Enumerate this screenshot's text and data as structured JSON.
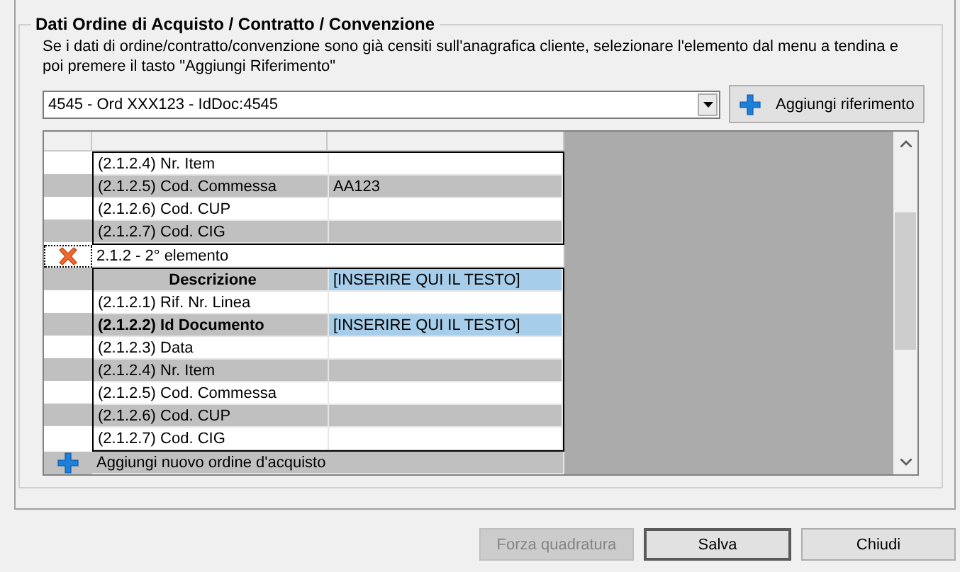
{
  "group": {
    "title": "Dati Ordine di Acquisto / Contratto / Convenzione",
    "instructions": "Se i dati di ordine/contratto/convenzione sono già censiti sull'anagrafica cliente, selezionare l'elemento dal menu a tendina e poi premere il tasto \"Aggiungi Riferimento\"",
    "reference_select": {
      "value": "4545 - Ord XXX123 - IdDoc:4545"
    },
    "add_reference_button": "Aggiungi riferimento",
    "grid": {
      "sections": [
        {
          "kind": "fields",
          "rows": [
            {
              "kind": "field",
              "label": "(2.1.2.4) Nr. Item",
              "required": false
            },
            {
              "kind": "field",
              "label": "(2.1.2.5) Cod. Commessa",
              "value": "AA123",
              "required": false
            },
            {
              "kind": "field",
              "label": "(2.1.2.6) Cod. CUP",
              "required": false
            },
            {
              "kind": "field",
              "label": "(2.1.2.7) Cod. CIG",
              "required": false
            }
          ]
        },
        {
          "kind": "element",
          "label": "2.1.2 - 2° elemento"
        },
        {
          "kind": "fields",
          "rows": [
            {
              "kind": "header",
              "label": "Descrizione",
              "value": "[INSERIRE QUI IL TESTO]",
              "required": true
            },
            {
              "kind": "field",
              "label": "(2.1.2.1) Rif. Nr. Linea",
              "required": false
            },
            {
              "kind": "field",
              "label": "(2.1.2.2) Id Documento",
              "value": "[INSERIRE QUI IL TESTO]",
              "required": true
            },
            {
              "kind": "field",
              "label": "(2.1.2.3) Data",
              "required": false
            },
            {
              "kind": "field",
              "label": "(2.1.2.4) Nr. Item",
              "required": false
            },
            {
              "kind": "field",
              "label": "(2.1.2.5) Cod. Commessa",
              "required": false
            },
            {
              "kind": "field",
              "label": "(2.1.2.6) Cod. CUP",
              "required": false
            },
            {
              "kind": "field",
              "label": "(2.1.2.7) Cod. CIG",
              "required": false
            }
          ]
        },
        {
          "kind": "add",
          "label": "Aggiungi nuovo ordine d'acquisto"
        }
      ]
    }
  },
  "buttons": [
    {
      "label": "Forza quadratura",
      "disabled": true,
      "default": false
    },
    {
      "label": "Salva",
      "disabled": false,
      "default": true
    },
    {
      "label": "Chiudi",
      "disabled": false,
      "default": false
    }
  ]
}
